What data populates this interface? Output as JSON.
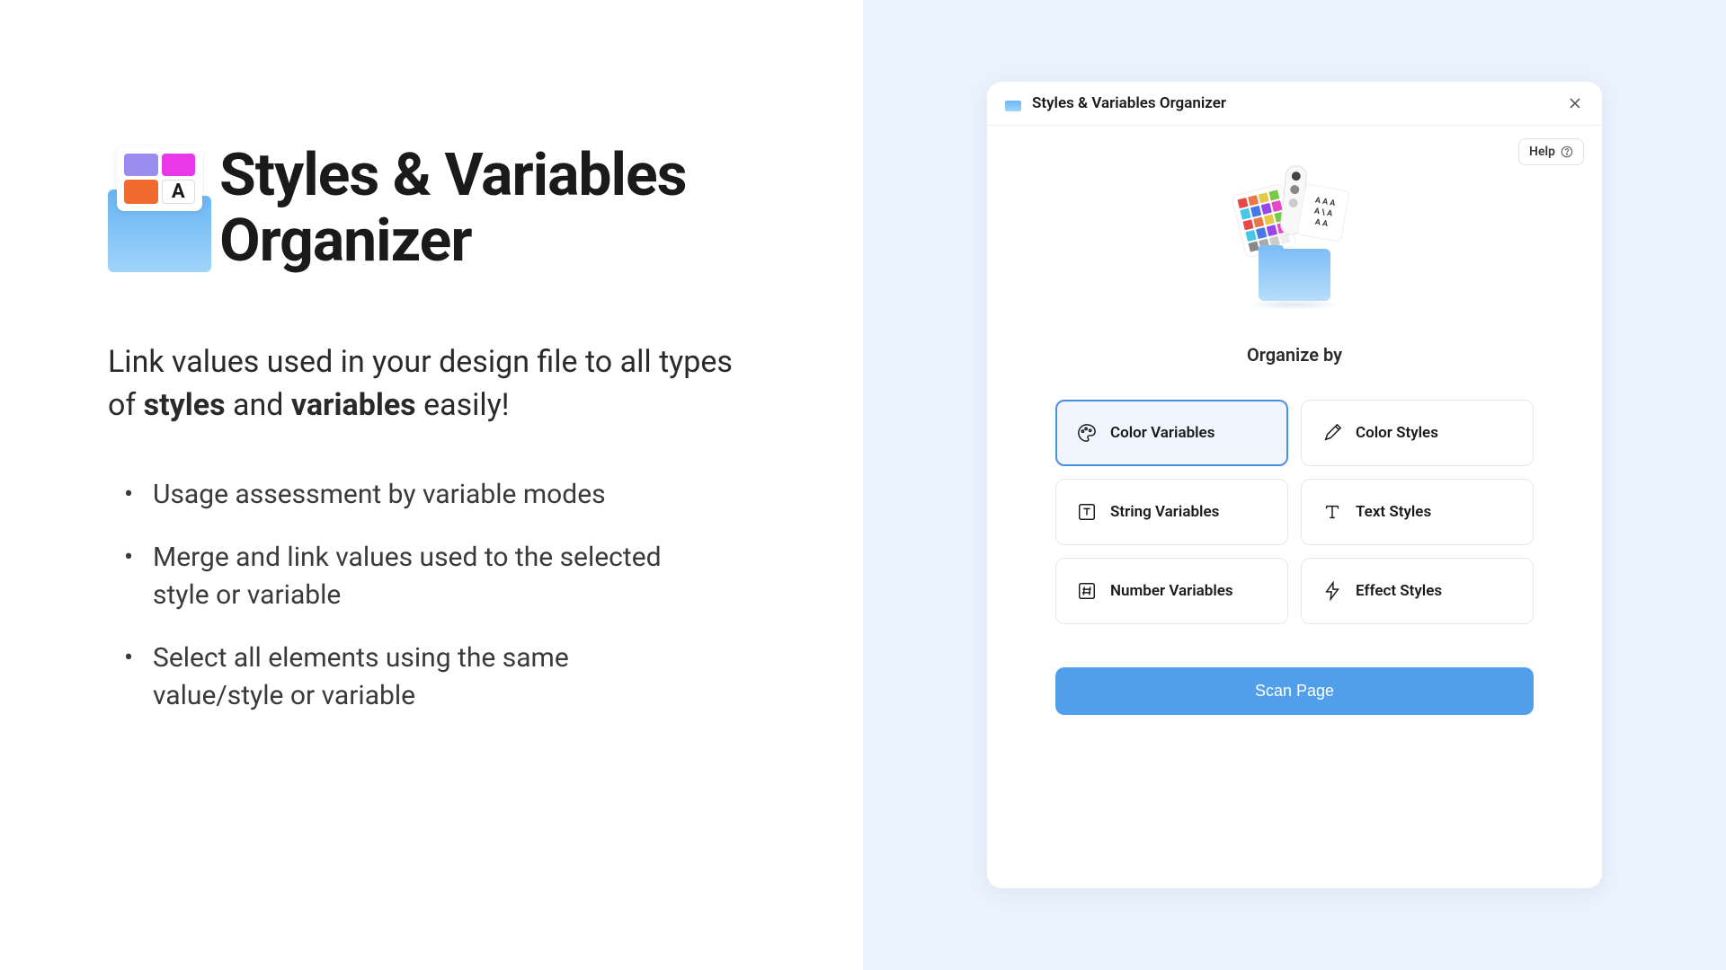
{
  "hero": {
    "title": "Styles & Variables Organizer",
    "letter": "A"
  },
  "description": {
    "part1": "Link values used in your design file to all types of ",
    "bold1": "styles",
    "part2": " and ",
    "bold2": "variables",
    "part3": " easily!"
  },
  "features": [
    "Usage assessment by variable modes",
    "Merge and link values used to the selected style or variable",
    "Select all elements using the same value/style or variable"
  ],
  "modal": {
    "title": "Styles & Variables Organizer",
    "help_label": "Help",
    "organize_label": "Organize by",
    "options": [
      {
        "label": "Color Variables",
        "icon": "palette",
        "selected": true
      },
      {
        "label": "Color Styles",
        "icon": "eyedropper",
        "selected": false
      },
      {
        "label": "String Variables",
        "icon": "text-box",
        "selected": false
      },
      {
        "label": "Text Styles",
        "icon": "text-t",
        "selected": false
      },
      {
        "label": "Number Variables",
        "icon": "hash-box",
        "selected": false
      },
      {
        "label": "Effect Styles",
        "icon": "lightning",
        "selected": false
      }
    ],
    "scan_label": "Scan Page"
  }
}
